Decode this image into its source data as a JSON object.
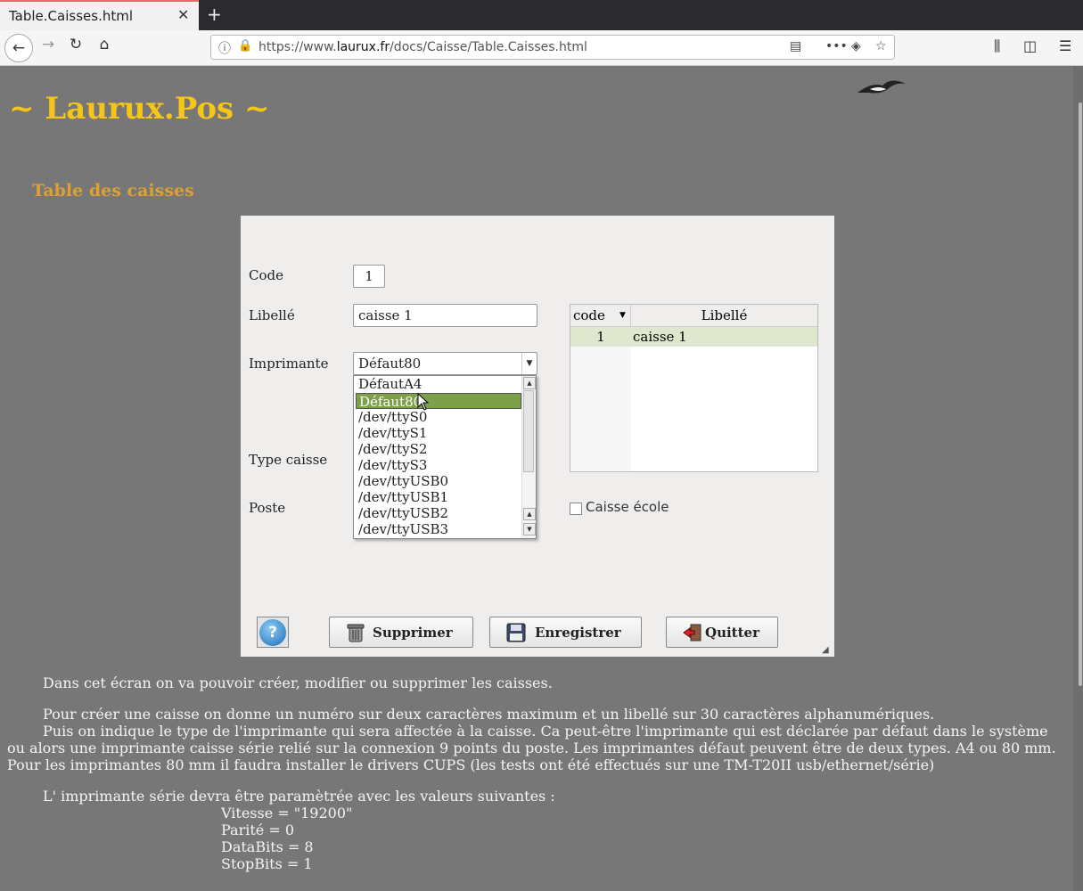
{
  "browser": {
    "tab_title": "Table.Caisses.html",
    "tab_close": "✕",
    "new_tab": "+",
    "url_prefix": "https://www.",
    "url_domain": "laurux.fr",
    "url_path": "/docs/Caisse/Table.Caisses.html",
    "url_more": "•••"
  },
  "page": {
    "title": "~ Laurux.Pos ~",
    "section_heading": "Table des caisses"
  },
  "form": {
    "labels": {
      "code": "Code",
      "libelle": "Libellé",
      "imprimante": "Imprimante",
      "type_caisse": "Type caisse",
      "poste": "Poste"
    },
    "code_value": "1",
    "libelle_value": "caisse 1",
    "imprimante_value": "Défaut80",
    "printer_options": [
      "DéfautA4",
      "Défaut80",
      "/dev/ttyS0",
      "/dev/ttyS1",
      "/dev/ttyS2",
      "/dev/ttyS3",
      "/dev/ttyUSB0",
      "/dev/ttyUSB1",
      "/dev/ttyUSB2",
      "/dev/ttyUSB3"
    ],
    "selected_option": "Défaut80",
    "table": {
      "headers": [
        "code",
        "Libellé"
      ],
      "rows": [
        {
          "code": "1",
          "libelle": "caisse 1"
        }
      ]
    },
    "caisse_ecole_label": "Caisse école",
    "buttons": {
      "help": "?",
      "delete": "Supprimer",
      "save": "Enregistrer",
      "quit": "Quitter"
    }
  },
  "body_text": {
    "p1": "Dans cet écran on va pouvoir créer, modifier ou supprimer les caisses.",
    "p2": "Pour créer une caisse on donne un numéro sur deux caractères maximum et un libellé sur 30 caractères alphanumériques.",
    "p3": "Puis on indique le type de l'imprimante qui sera affectée à la caisse. Ca peut-être l'imprimante qui est déclarée par défaut dans le système ou alors une imprimante caisse série relié sur la connexion 9 points du poste. Les imprimantes défaut peuvent être de deux types. A4 ou 80 mm. Pour les imprimantes 80 mm il faudra installer le drivers CUPS (les tests ont été effectués sur une TM-T20II usb/ethernet/série)",
    "p4": "L' imprimante série devra être paramètrée avec les valeurs suivantes :",
    "serial_settings": [
      "Vitesse = \"19200\"",
      "Parité = 0",
      "DataBits = 8",
      "StopBits = 1"
    ]
  },
  "colors": {
    "page_bg": "#777777",
    "title": "#f5c518",
    "heading": "#e0a030",
    "selection": "#7fa04a",
    "row_highlight": "#dfe8cf"
  }
}
